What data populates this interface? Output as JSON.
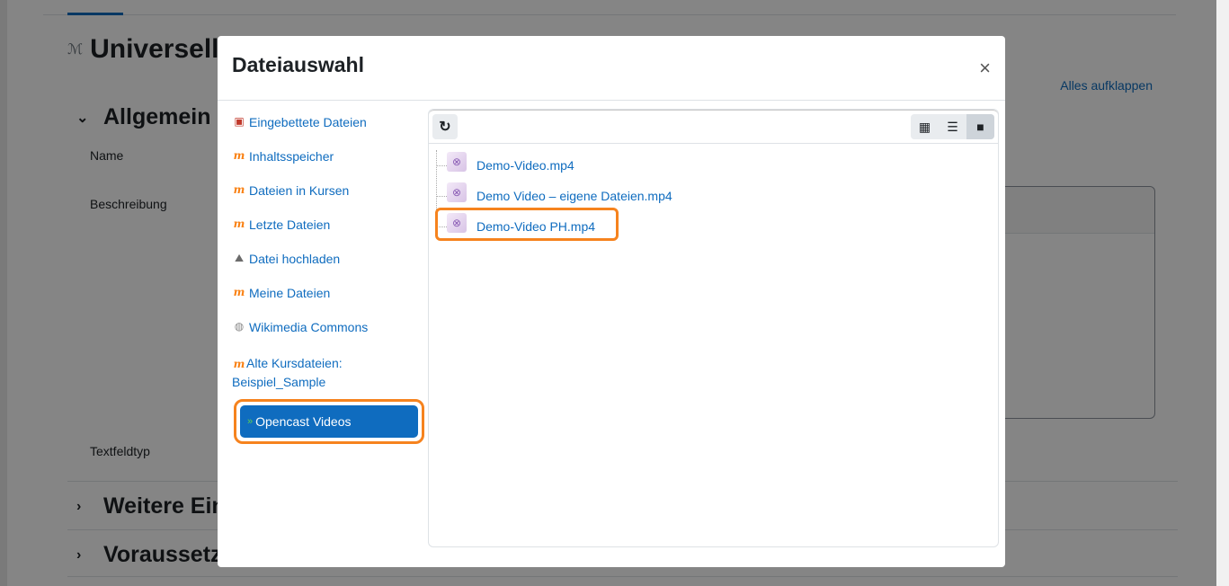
{
  "background": {
    "page_title": "Universelle",
    "expand_all": "Alles aufklappen",
    "sections": [
      {
        "label": "Allgemein",
        "chevron": "⌄"
      },
      {
        "label": "Weitere Eins",
        "chevron": "›"
      },
      {
        "label": "Voraussetzu",
        "chevron": "›"
      }
    ],
    "fields": {
      "name": "Name",
      "description": "Beschreibung",
      "textfield_type": "Textfeldtyp"
    }
  },
  "modal": {
    "title": "Dateiauswahl",
    "close": "×",
    "repositories": [
      {
        "label": "Eingebettete Dateien",
        "icon": "pdf-file-icon"
      },
      {
        "label": "Inhaltsspeicher",
        "icon": "moodle-icon"
      },
      {
        "label": "Dateien in Kursen",
        "icon": "moodle-icon"
      },
      {
        "label": "Letzte Dateien",
        "icon": "moodle-icon"
      },
      {
        "label": "Datei hochladen",
        "icon": "upload-icon"
      },
      {
        "label": "Meine Dateien",
        "icon": "moodle-icon"
      },
      {
        "label": "Wikimedia Commons",
        "icon": "wikimedia-icon"
      },
      {
        "label": "Alte Kursdateien: Beispiel_Sample",
        "icon": "moodle-icon"
      }
    ],
    "active_repository": {
      "label": "Opencast Videos",
      "icon": "opencast-icon"
    },
    "files": [
      {
        "name": "Demo-Video.mp4"
      },
      {
        "name": "Demo Video – eigene Dateien.mp4"
      },
      {
        "name": "Demo-Video PH.mp4"
      }
    ],
    "toolbar": {
      "refresh_icon": "refresh-icon",
      "views": [
        "icons-view-icon",
        "list-view-icon",
        "tree-view-icon"
      ]
    }
  },
  "colors": {
    "link": "#0f6cbf",
    "highlight": "#f6831e",
    "moodle_orange": "#f98012"
  }
}
